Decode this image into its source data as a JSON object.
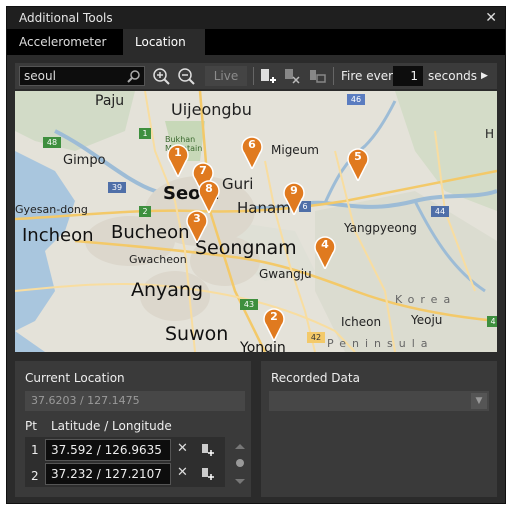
{
  "window": {
    "title": "Additional Tools",
    "close_glyph": "✕"
  },
  "tabs": [
    {
      "label": "Accelerometer",
      "active": false
    },
    {
      "label": "Location",
      "active": true
    }
  ],
  "toolbar": {
    "search_value": "seoul",
    "live_label": "Live",
    "fire_every_label": "Fire every",
    "fire_every_value": "1",
    "seconds_label": "seconds",
    "play_glyph": "▶",
    "icons": [
      "search-icon",
      "zoom-in-icon",
      "zoom-out-icon",
      "add-pushpin-icon",
      "clear-pins-icon",
      "clear-map-icon"
    ]
  },
  "map": {
    "place_labels": [
      "Paju",
      "Uijeongbu",
      "Bukhan Mountain",
      "Gimpo",
      "Seoul",
      "Guri",
      "Migeum",
      "Gyesan-dong",
      "Hanam",
      "Incheon",
      "Bucheon",
      "Seongnam",
      "Yangpyeong",
      "Gwacheon",
      "Gwangju",
      "Anyang",
      "Korea",
      "Icheon",
      "Yeoju",
      "Suwon",
      "Yongin",
      "Peninsula",
      "H"
    ],
    "road_labels": [
      "46",
      "1",
      "48",
      "39",
      "2",
      "6",
      "44",
      "43",
      "42",
      "4"
    ],
    "pins": [
      "1",
      "2",
      "3",
      "4",
      "5",
      "6",
      "7",
      "8",
      "9"
    ],
    "accent_color": "#e07a1f"
  },
  "current_location": {
    "title": "Current Location",
    "value": "37.6203 / 127.1475",
    "pt_label": "Pt",
    "latlong_label": "Latitude / Longitude",
    "rows": [
      {
        "num": "1",
        "value": "37.592 / 126.9635"
      },
      {
        "num": "2",
        "value": "37.232 / 127.2107"
      }
    ],
    "remove_glyph": "✕"
  },
  "recorded_data": {
    "title": "Recorded Data",
    "arrow_glyph": "▼"
  }
}
